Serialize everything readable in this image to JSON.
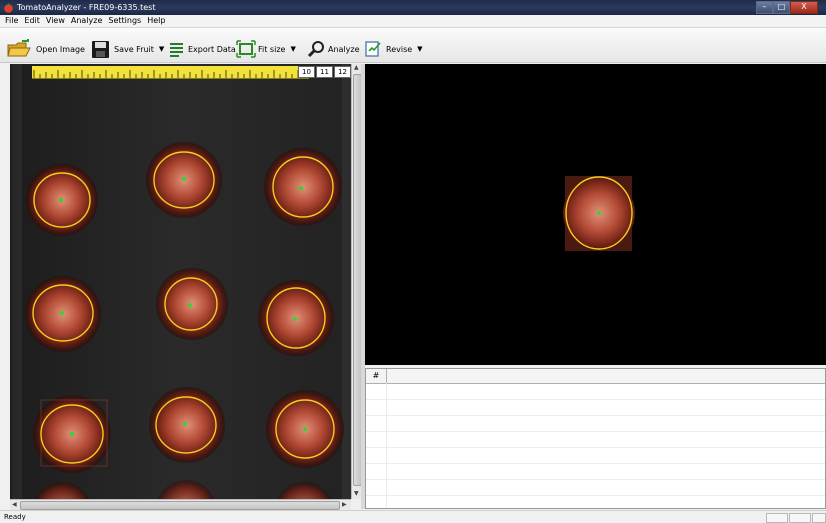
{
  "window": {
    "title": "TomatoAnalyzer - FRE09-6335.test",
    "minimize": "–",
    "maximize": "□",
    "close": "X"
  },
  "menu": [
    "File",
    "Edit",
    "View",
    "Analyze",
    "Settings",
    "Help"
  ],
  "toolbar": {
    "open_image": "Open Image",
    "save_fruit": "Save Fruit",
    "export_data": "Export Data",
    "fit_size": "Fit size",
    "analyze": "Analyze",
    "revise": "Revise"
  },
  "ruler": {
    "boxes": [
      "10",
      "11",
      "12"
    ]
  },
  "grid": {
    "header": "#"
  },
  "status": {
    "text": "Ready"
  },
  "colors": {
    "outline": "#f0d020",
    "center": "#22dd33",
    "ruler": "#f2e23a"
  }
}
